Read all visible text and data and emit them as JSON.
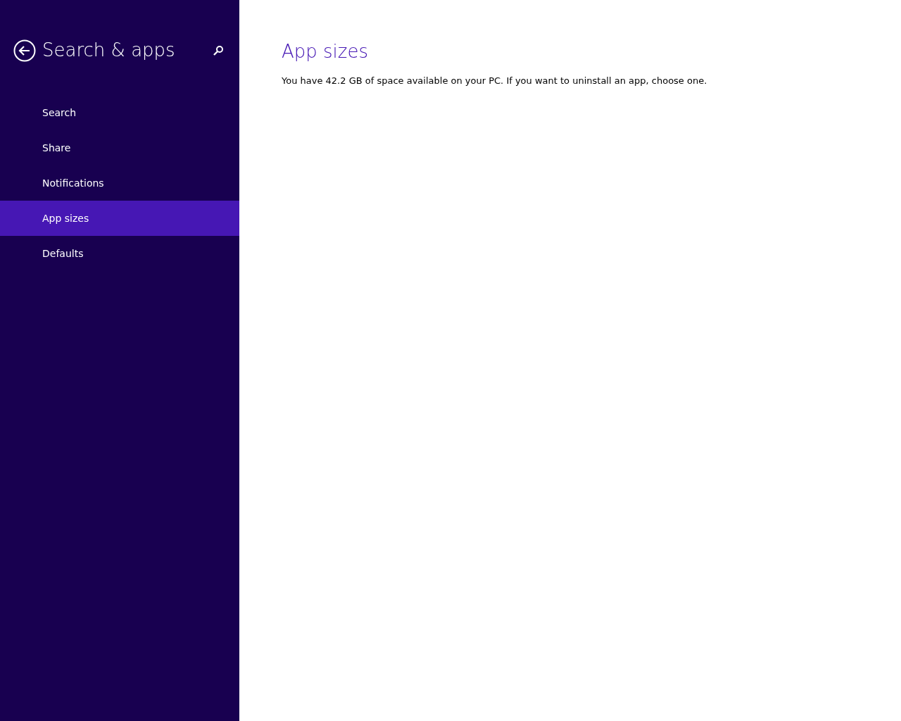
{
  "sidebar": {
    "title": "Search & apps",
    "items": [
      {
        "label": "Search",
        "selected": false
      },
      {
        "label": "Share",
        "selected": false
      },
      {
        "label": "Notifications",
        "selected": false
      },
      {
        "label": "App sizes",
        "selected": true
      },
      {
        "label": "Defaults",
        "selected": false
      }
    ]
  },
  "content": {
    "heading": "App sizes",
    "description": "You have 42.2 GB of space available on your PC. If you want to uninstall an app, choose one."
  }
}
